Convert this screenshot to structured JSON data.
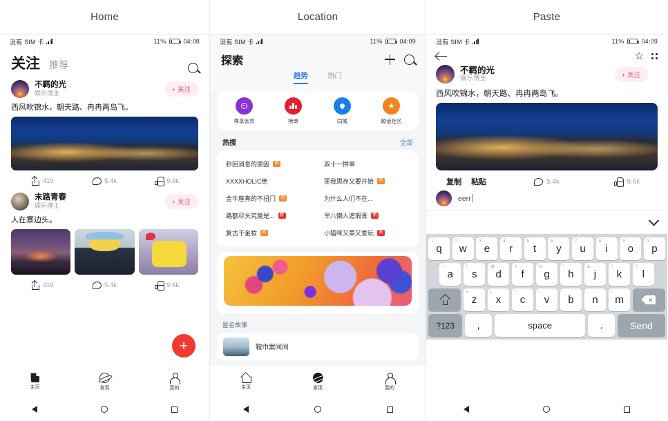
{
  "panels": [
    {
      "title": "Home"
    },
    {
      "title": "Location"
    },
    {
      "title": "Paste"
    }
  ],
  "home": {
    "status": {
      "carrier": "没有 SIM 卡",
      "battery": "11%",
      "time": "04:08"
    },
    "tabs": {
      "active": "关注",
      "idle": "推荐"
    },
    "search_icon": "search-icon",
    "posts": [
      {
        "user": "不羁的光",
        "role": "娱乐博主",
        "follow": "+ 关注",
        "text": "西风吹锦水，朝天路、冉冉两岛飞。",
        "stats": {
          "share": "419",
          "comment": "5.4k",
          "like": "9.6k"
        }
      },
      {
        "user": "末路青春",
        "role": "娱乐博主",
        "follow": "+ 关注",
        "text": "人在寨边头。",
        "stats": {
          "share": "419",
          "comment": "5.4k",
          "like": "9.6k"
        }
      }
    ],
    "fab": "+",
    "tabbar": [
      {
        "label": "主页",
        "icon": "home-icon"
      },
      {
        "label": "发现",
        "icon": "discover-icon"
      },
      {
        "label": "我的",
        "icon": "profile-icon"
      }
    ]
  },
  "location": {
    "status": {
      "carrier": "没有 SIM 卡",
      "battery": "11%",
      "time": "04:09"
    },
    "title": "探索",
    "tools": {
      "plus": "+",
      "search": "search-icon"
    },
    "tabs": [
      {
        "label": "趋势",
        "active": true
      },
      {
        "label": "热门",
        "active": false
      }
    ],
    "categories": [
      {
        "label": "尊享会员",
        "color": "#8b2fd6",
        "icon": "medal-icon"
      },
      {
        "label": "榜单",
        "color": "#e41f2d",
        "icon": "chart-icon"
      },
      {
        "label": "同城",
        "color": "#1580e8",
        "icon": "pin-icon"
      },
      {
        "label": "超话社区",
        "color": "#f58220",
        "icon": "star-icon"
      }
    ],
    "hot_header": {
      "left": "热搜",
      "right": "全部"
    },
    "hot_items": [
      {
        "text": "秒回消息的原因",
        "tag": "热"
      },
      {
        "text": "双十一拼单",
        "tag": ""
      },
      {
        "text": "XXXXHOLIC绝",
        "tag": ""
      },
      {
        "text": "匪我思存又要开始",
        "tag": "热"
      },
      {
        "text": "金牛座真的不扭门",
        "tag": "热"
      },
      {
        "text": "为什么人们不在...",
        "tag": ""
      },
      {
        "text": "路额尽头究竟是...",
        "tag": "新"
      },
      {
        "text": "早八懒人遮瑕膏",
        "tag": "新"
      },
      {
        "text": "复古千金妆",
        "tag": "热"
      },
      {
        "text": "小猫咪又菜又爱玩",
        "tag": "新"
      }
    ],
    "banner": "banner-image",
    "story_label": "匿名故事",
    "story_title": "鞍巾案间间",
    "tabbar": [
      {
        "label": "主页",
        "icon": "home-icon"
      },
      {
        "label": "发现",
        "icon": "discover-icon"
      },
      {
        "label": "我的",
        "icon": "profile-icon"
      }
    ]
  },
  "paste": {
    "status": {
      "carrier": "没有 SIM 卡",
      "battery": "11%",
      "time": "04:09"
    },
    "back": "back-icon",
    "star": "star-icon",
    "more": "more-icon",
    "user": "不羁的光",
    "role": "娱乐博主",
    "follow": "+ 关注",
    "text": "西风吹锦水，朝天路、冉冉两岛飞。",
    "context_menu": [
      "复制",
      "粘贴"
    ],
    "stats": {
      "comment": "5.4k",
      "like": "9.6k"
    },
    "input_value": "eerr",
    "keyboard": {
      "row1": [
        {
          "k": "q",
          "alt": "1"
        },
        {
          "k": "w",
          "alt": "2"
        },
        {
          "k": "e",
          "alt": "3"
        },
        {
          "k": "r",
          "alt": "4"
        },
        {
          "k": "t",
          "alt": "5"
        },
        {
          "k": "y",
          "alt": "6"
        },
        {
          "k": "u",
          "alt": "7"
        },
        {
          "k": "i",
          "alt": "8"
        },
        {
          "k": "o",
          "alt": "9"
        },
        {
          "k": "p",
          "alt": "0"
        }
      ],
      "row2": [
        {
          "k": "a",
          "alt": "~"
        },
        {
          "k": "s",
          "alt": "!"
        },
        {
          "k": "d",
          "alt": "@"
        },
        {
          "k": "f",
          "alt": "#"
        },
        {
          "k": "g",
          "alt": "%"
        },
        {
          "k": "h",
          "alt": "'"
        },
        {
          "k": "j",
          "alt": "&"
        },
        {
          "k": "k",
          "alt": "*"
        },
        {
          "k": "l",
          "alt": "?"
        }
      ],
      "row3": [
        {
          "k": "z",
          "alt": "+"
        },
        {
          "k": "x",
          "alt": "|"
        },
        {
          "k": "c",
          "alt": "\""
        },
        {
          "k": "v",
          "alt": "-"
        },
        {
          "k": "b",
          "alt": ":"
        },
        {
          "k": "n",
          "alt": ";"
        },
        {
          "k": "m",
          "alt": "/"
        }
      ],
      "shift": "shift-icon",
      "backspace": "backspace-icon",
      "sym": "?123",
      "comma": ",",
      "space": "space",
      "period": ".",
      "send": "Send"
    }
  },
  "colors": {
    "accent_red": "#ef3b2f",
    "follow_pink": "#f2536d",
    "tab_blue": "#2f7ae5",
    "tag_hot": "#f08a33",
    "tag_new": "#e5362f"
  }
}
